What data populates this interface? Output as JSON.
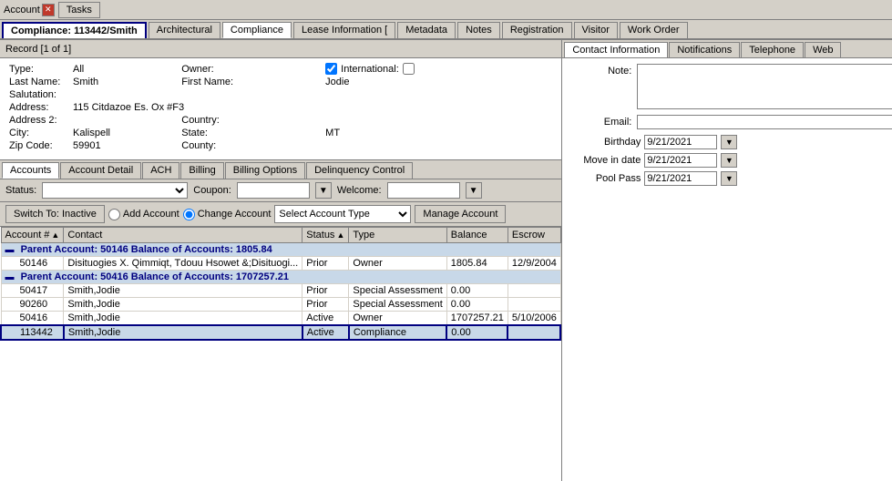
{
  "titlebar": {
    "account_label": "Account",
    "tasks_label": "Tasks"
  },
  "compliance_tab": "Compliance:  113442/Smith",
  "tabs": [
    {
      "label": "Architectural"
    },
    {
      "label": "Compliance"
    },
    {
      "label": "Lease Information ["
    },
    {
      "label": "Metadata"
    },
    {
      "label": "Notes"
    },
    {
      "label": "Registration"
    },
    {
      "label": "Visitor"
    },
    {
      "label": "Work Order"
    }
  ],
  "record_bar": "Record [1 of 1]",
  "form": {
    "type_label": "Type:",
    "type_value": "All",
    "owner_label": "Owner:",
    "international_label": "International:",
    "lastname_label": "Last Name:",
    "lastname_value": "Smith",
    "firstname_label": "First Name:",
    "firstname_value": "Jodie",
    "salutation_label": "Salutation:",
    "address_label": "Address:",
    "address_value": "115 Citdazoe Es. Ox #F3",
    "address2_label": "Address 2:",
    "country_label": "Country:",
    "city_label": "City:",
    "city_value": "Kalispell",
    "state_label": "State:",
    "state_value": "MT",
    "zipcode_label": "Zip Code:",
    "zipcode_value": "59901",
    "county_label": "County:"
  },
  "sub_tabs": [
    {
      "label": "Accounts"
    },
    {
      "label": "Account Detail"
    },
    {
      "label": "ACH"
    },
    {
      "label": "Billing"
    },
    {
      "label": "Billing Options"
    },
    {
      "label": "Delinquency Control"
    }
  ],
  "status_bar": {
    "status_label": "Status:",
    "coupon_label": "Coupon:",
    "welcome_label": "Welcome:"
  },
  "action_bar": {
    "switch_btn": "Switch To: Inactive",
    "add_btn": "Add Account",
    "change_label": "Change Account",
    "select_placeholder": "Select Account Type",
    "manage_btn": "Manage Account"
  },
  "table": {
    "columns": [
      "Account #",
      "Contact",
      "Status",
      "Type",
      "Balance",
      "Escrow"
    ],
    "parent1": {
      "label": "Parent Account: 50146 Balance of Accounts: 1805.84",
      "rows": [
        {
          "account": "50146",
          "contact": "Disituogies X. Qimmiqt, Tdouu Hsowet &;Disituogi...",
          "status": "Prior",
          "type": "Owner",
          "balance": "1805.84",
          "escrow": "12/9/2004"
        }
      ]
    },
    "parent2": {
      "label": "Parent Account: 50416 Balance of Accounts: 1707257.21",
      "rows": [
        {
          "account": "50417",
          "contact": "Smith,Jodie",
          "status": "Prior",
          "type": "Special Assessment",
          "balance": "0.00",
          "escrow": ""
        },
        {
          "account": "90260",
          "contact": "Smith,Jodie",
          "status": "Prior",
          "type": "Special Assessment",
          "balance": "0.00",
          "escrow": ""
        },
        {
          "account": "50416",
          "contact": "Smith,Jodie",
          "status": "Active",
          "type": "Owner",
          "balance": "1707257.21",
          "escrow": "5/10/2006"
        },
        {
          "account": "113442",
          "contact": "Smith,Jodie",
          "status": "Active",
          "type": "Compliance",
          "balance": "0.00",
          "escrow": ""
        }
      ]
    }
  },
  "right_panel": {
    "tabs": [
      {
        "label": "Contact Information"
      },
      {
        "label": "Notifications"
      },
      {
        "label": "Telephone"
      },
      {
        "label": "Web"
      }
    ],
    "note_label": "Note:",
    "email_label": "Email:",
    "birthday_label": "Birthday",
    "birthday_value": "9/21/2021",
    "movein_label": "Move in date",
    "movein_value": "9/21/2021",
    "poolpass_label": "Pool Pass",
    "poolpass_value": "9/21/2021"
  }
}
